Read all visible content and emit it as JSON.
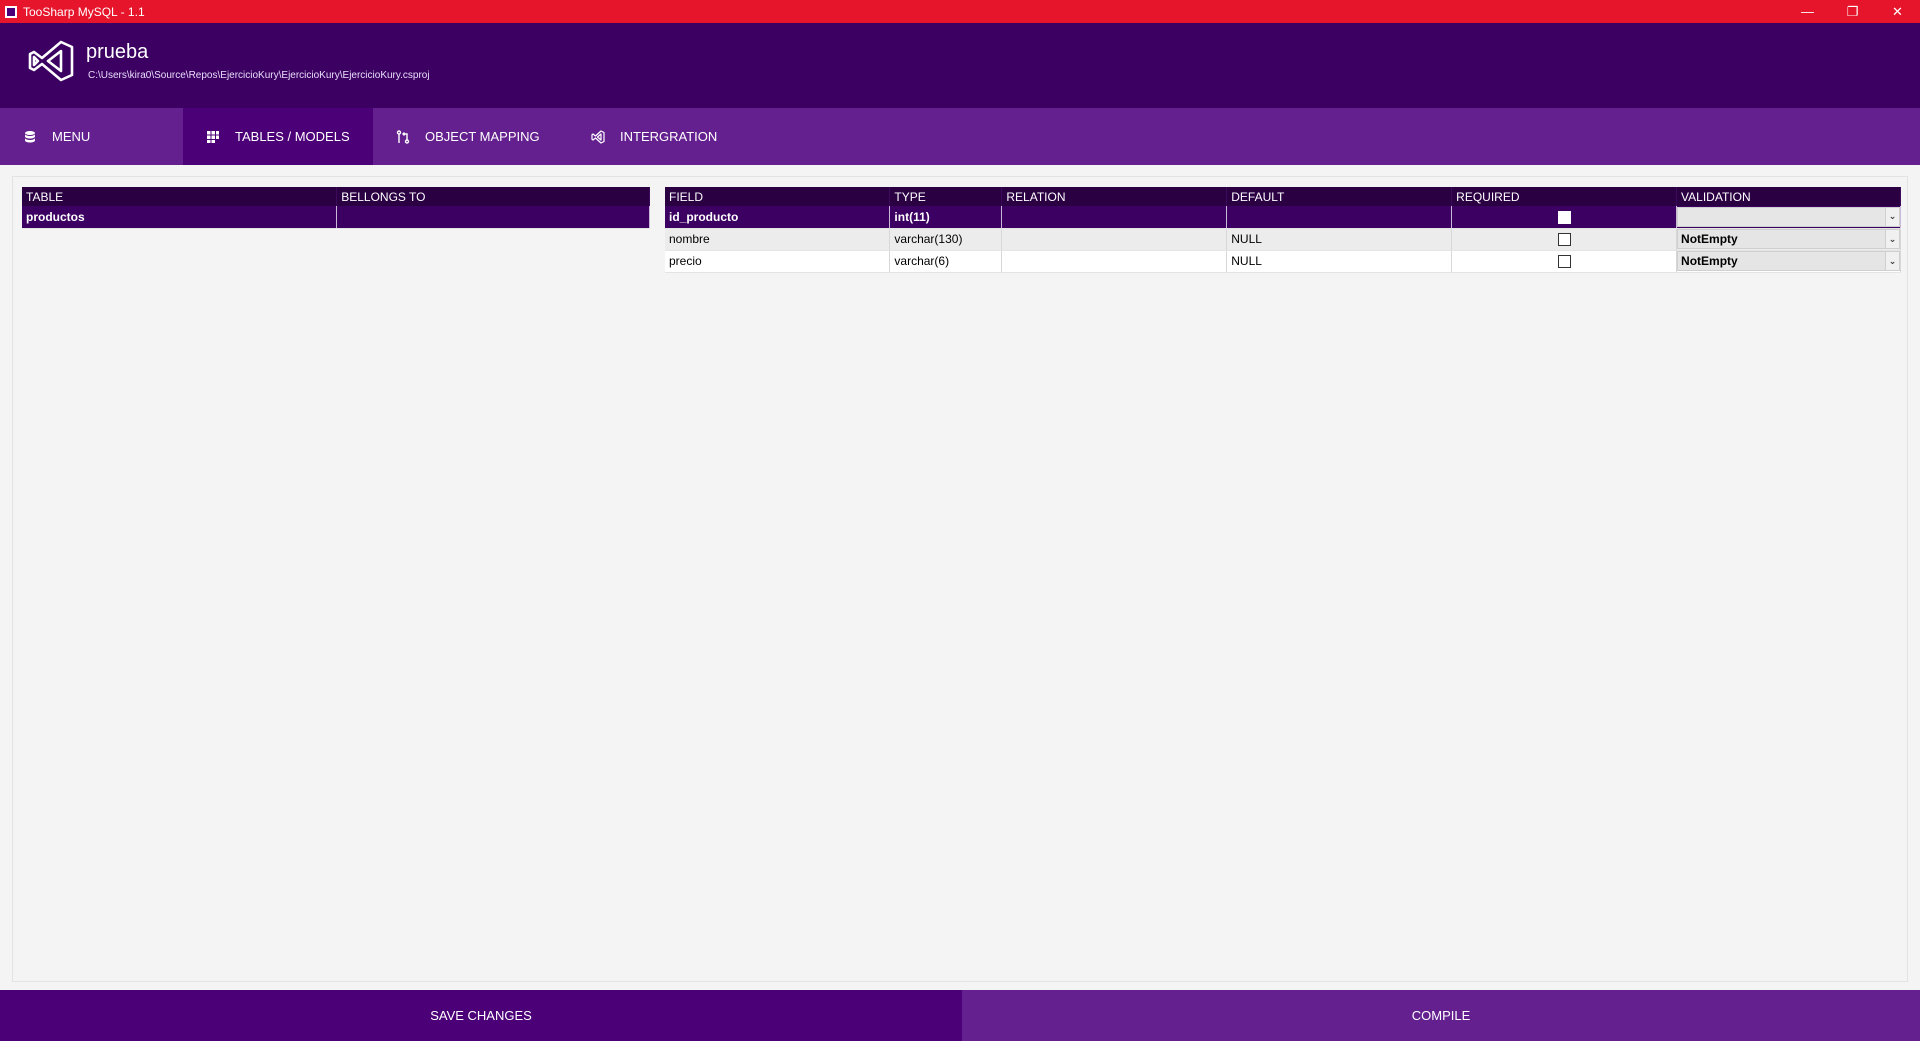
{
  "window": {
    "title": "TooSharp MySQL - 1.1",
    "controls": {
      "minimize": "—",
      "restore": "❐",
      "close": "✕"
    }
  },
  "project": {
    "name": "prueba",
    "path": "C:\\Users\\kira0\\Source\\Repos\\EjercicioKury\\EjercicioKury\\EjercicioKury.csproj"
  },
  "nav": {
    "items": [
      {
        "label": "MENU",
        "icon": "database-icon"
      },
      {
        "label": "TABLES /  MODELS",
        "icon": "grid-icon"
      },
      {
        "label": "OBJECT MAPPING",
        "icon": "mapping-icon"
      },
      {
        "label": "INTERGRATION",
        "icon": "visual-studio-icon"
      }
    ],
    "active": "TABLES /  MODELS"
  },
  "tables_grid": {
    "headers": [
      "TABLE",
      "BELLONGS TO"
    ],
    "rows": [
      {
        "table": "productos",
        "belongs_to": ""
      }
    ]
  },
  "fields_grid": {
    "headers": [
      "FIELD",
      "TYPE",
      "RELATION",
      "DEFAULT",
      "REQUIRED",
      "VALIDATION"
    ],
    "rows": [
      {
        "field": "id_producto",
        "type": "int(11)",
        "relation": "",
        "default": "",
        "required": true,
        "validation": ""
      },
      {
        "field": "nombre",
        "type": "varchar(130)",
        "relation": "",
        "default": "NULL",
        "required": false,
        "validation": "NotEmpty"
      },
      {
        "field": "precio",
        "type": "varchar(6)",
        "relation": "",
        "default": "NULL",
        "required": false,
        "validation": "NotEmpty"
      }
    ]
  },
  "actions": {
    "save_label": "SAVE CHANGES",
    "compile_label": "COMPILE"
  },
  "colors": {
    "titlebar": "#e6152b",
    "header": "#3b0062",
    "nav": "#65208f",
    "nav_active": "#4c0078",
    "grid_header": "#2a0042"
  }
}
